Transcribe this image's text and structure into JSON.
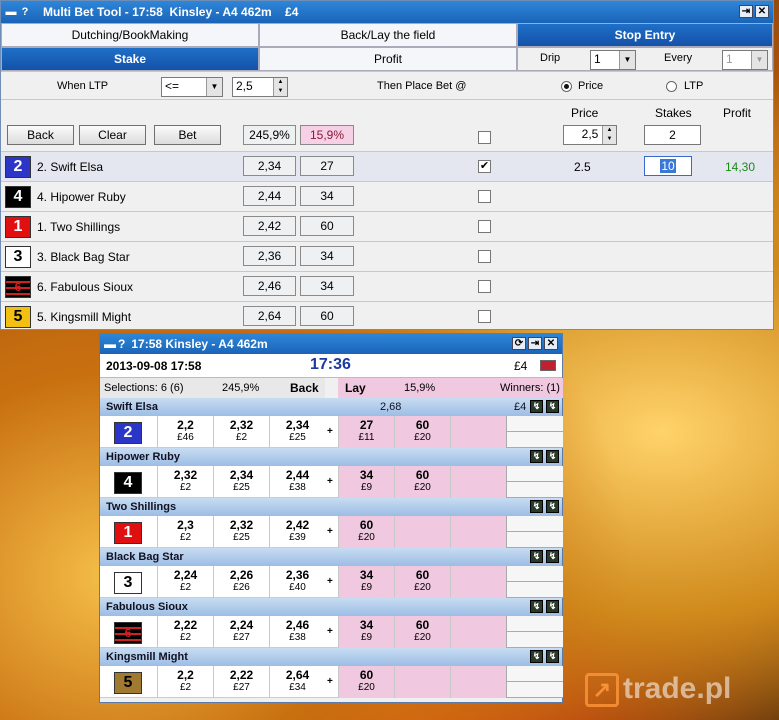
{
  "multibet": {
    "title": "Multi Bet Tool - 17:58  Kinsley - A4 462m    £4",
    "tabs": [
      "Dutching/BookMaking",
      "Back/Lay the field",
      "Stop Entry"
    ],
    "subtabs": [
      "Stake",
      "Profit"
    ],
    "drip_label": "Drip",
    "drip_value": "1",
    "every_label": "Every",
    "every_value": "1",
    "when_ltp_label": "When LTP",
    "operator": "<=",
    "ltp_value": "2,5",
    "then_place_label": "Then Place Bet @",
    "radio_price": "Price",
    "radio_ltp": "LTP",
    "col_price": "Price",
    "col_stakes": "Stakes",
    "col_profit": "Profit",
    "btn_back": "Back",
    "btn_clear": "Clear",
    "btn_bet": "Bet",
    "book_back": "245,9%",
    "book_lay": "15,9%",
    "header_price": "2,5",
    "header_stake": "2",
    "runners": [
      {
        "num": "2",
        "name": "2. Swift Elsa",
        "odds": "2,34",
        "vol": "27",
        "checked": "✔",
        "price": "2.5",
        "stake": "10",
        "profit": "14,30"
      },
      {
        "num": "4",
        "name": "4. Hipower Ruby",
        "odds": "2,44",
        "vol": "34",
        "checked": "",
        "price": "",
        "stake": "",
        "profit": ""
      },
      {
        "num": "1",
        "name": "1. Two Shillings",
        "odds": "2,42",
        "vol": "60",
        "checked": "",
        "price": "",
        "stake": "",
        "profit": ""
      },
      {
        "num": "3",
        "name": "3. Black Bag Star",
        "odds": "2,36",
        "vol": "34",
        "checked": "",
        "price": "",
        "stake": "",
        "profit": ""
      },
      {
        "num": "6",
        "name": "6. Fabulous Sioux",
        "odds": "2,46",
        "vol": "34",
        "checked": "",
        "price": "",
        "stake": "",
        "profit": ""
      },
      {
        "num": "5",
        "name": "5. Kingsmill Might",
        "odds": "2,64",
        "vol": "60",
        "checked": "",
        "price": "",
        "stake": "",
        "profit": ""
      }
    ],
    "colors": {
      "title_blue": "#1a64b8",
      "profit_green": "#1a8a1a"
    }
  },
  "market": {
    "title": "17:58  Kinsley - A4 462m",
    "date": "2013-09-08  17:58",
    "clock": "17:36",
    "amount": "£4",
    "selections": "Selections: 6 (6)",
    "back_pct": "245,9%",
    "back": "Back",
    "lay": "Lay",
    "lay_pct": "15,9%",
    "winners": "Winners: (1)",
    "runners": [
      {
        "name": "Swift Elsa",
        "num": "2",
        "extra": "2,68",
        "stake": "£4",
        "back": [
          [
            "2,2",
            "£46"
          ],
          [
            "2,32",
            "£2"
          ],
          [
            "2,34",
            "£25"
          ]
        ],
        "lay": [
          [
            "27",
            "£11"
          ],
          [
            "60",
            "£20"
          ],
          [
            "",
            ""
          ]
        ]
      },
      {
        "name": "Hipower Ruby",
        "num": "4",
        "extra": "",
        "stake": "",
        "back": [
          [
            "2,32",
            "£2"
          ],
          [
            "2,34",
            "£25"
          ],
          [
            "2,44",
            "£38"
          ]
        ],
        "lay": [
          [
            "34",
            "£9"
          ],
          [
            "60",
            "£20"
          ],
          [
            "",
            ""
          ]
        ]
      },
      {
        "name": "Two Shillings",
        "num": "1",
        "extra": "",
        "stake": "",
        "back": [
          [
            "2,3",
            "£2"
          ],
          [
            "2,32",
            "£25"
          ],
          [
            "2,42",
            "£39"
          ]
        ],
        "lay": [
          [
            "60",
            "£20"
          ],
          [
            "",
            ""
          ],
          [
            "",
            ""
          ]
        ]
      },
      {
        "name": "Black Bag Star",
        "num": "3",
        "extra": "",
        "stake": "",
        "back": [
          [
            "2,24",
            "£2"
          ],
          [
            "2,26",
            "£26"
          ],
          [
            "2,36",
            "£40"
          ]
        ],
        "lay": [
          [
            "34",
            "£9"
          ],
          [
            "60",
            "£20"
          ],
          [
            "",
            ""
          ]
        ]
      },
      {
        "name": "Fabulous Sioux",
        "num": "6",
        "extra": "",
        "stake": "",
        "back": [
          [
            "2,22",
            "£2"
          ],
          [
            "2,24",
            "£27"
          ],
          [
            "2,46",
            "£38"
          ]
        ],
        "lay": [
          [
            "34",
            "£9"
          ],
          [
            "60",
            "£20"
          ],
          [
            "",
            ""
          ]
        ]
      },
      {
        "name": "Kingsmill Might",
        "num": "5",
        "extra": "",
        "stake": "",
        "back": [
          [
            "2,2",
            "£2"
          ],
          [
            "2,22",
            "£27"
          ],
          [
            "2,64",
            "£34"
          ]
        ],
        "lay": [
          [
            "60",
            "£20"
          ],
          [
            "",
            ""
          ],
          [
            "",
            ""
          ]
        ]
      }
    ]
  },
  "watermark": "trade.pl"
}
